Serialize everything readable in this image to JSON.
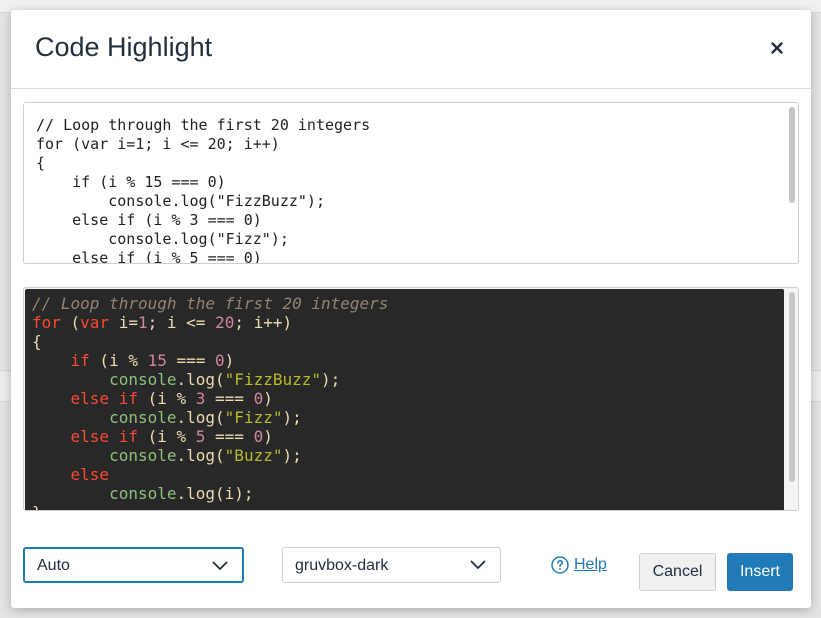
{
  "dialog": {
    "title": "Code Highlight"
  },
  "editor": {
    "code": "// Loop through the first 20 integers\nfor (var i=1; i <= 20; i++)\n{\n    if (i % 15 === 0)\n        console.log(\"FizzBuzz\");\n    else if (i % 3 === 0)\n        console.log(\"Fizz\");\n    else if (i % 5 === 0)\n        console.log(\"Buzz\");\n    else\n        console.log(i);\n}"
  },
  "preview": {
    "theme_colors": {
      "background": "#282828",
      "comment": "#928374",
      "keyword": "#fb4934",
      "number": "#d3869b",
      "string": "#b8bb26",
      "function": "#8ec07c",
      "text": "#ebdbb2"
    }
  },
  "footer": {
    "language_select": {
      "value": "Auto"
    },
    "theme_select": {
      "value": "gruvbox-dark"
    },
    "help_label": "Help",
    "cancel_label": "Cancel",
    "insert_label": "Insert"
  },
  "icons": {
    "close": "close-icon",
    "chevron": "chevron-down-icon",
    "help": "help-circle-icon"
  },
  "colors": {
    "accent": "#207ab7",
    "title_text": "#222f3e"
  }
}
